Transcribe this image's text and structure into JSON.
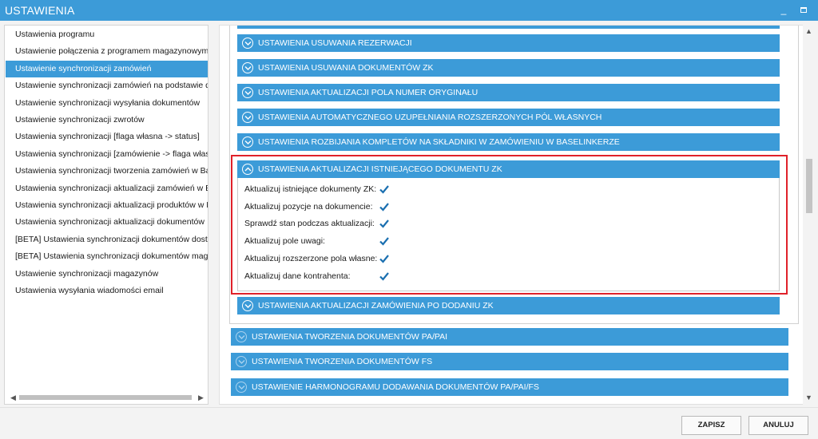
{
  "window": {
    "title": "USTAWIENIA",
    "minimize_icon": "minimize-icon",
    "maximize_icon": "maximize-icon"
  },
  "sidebar": {
    "items": [
      {
        "label": "Ustawienia programu",
        "selected": false
      },
      {
        "label": "Ustawienie połączenia z programem magazynowym",
        "selected": false
      },
      {
        "label": "Ustawienie synchronizacji zamówień",
        "selected": true
      },
      {
        "label": "Ustawienie synchronizacji zamówień na podstawie dzi",
        "selected": false
      },
      {
        "label": "Ustawienie synchronizacji wysyłania dokumentów",
        "selected": false
      },
      {
        "label": "Ustawienie synchronizacji zwrotów",
        "selected": false
      },
      {
        "label": "Ustawienia synchronizacji [flaga własna -> status]",
        "selected": false
      },
      {
        "label": "Ustawienia synchronizacji [zamówienie -> flaga własn",
        "selected": false
      },
      {
        "label": "Ustawienia synchronizacji tworzenia zamówień w Base",
        "selected": false
      },
      {
        "label": "Ustawienia synchronizacji aktualizacji zamówień w Ba",
        "selected": false
      },
      {
        "label": "Ustawienia synchronizacji aktualizacji produktów w Bas",
        "selected": false
      },
      {
        "label": "Ustawienia synchronizacji aktualizacji dokumentów",
        "selected": false
      },
      {
        "label": "[BETA] Ustawienia synchronizacji dokumentów dostaw",
        "selected": false
      },
      {
        "label": "[BETA] Ustawienia synchronizacji dokumentów magaz",
        "selected": false
      },
      {
        "label": "Ustawienie synchronizacji magazynów",
        "selected": false
      },
      {
        "label": "Ustawienia wysyłania wiadomości email",
        "selected": false
      }
    ]
  },
  "sections": {
    "inner": [
      "USTAWIENIA USUWANIA REZERWACJI",
      "USTAWIENIA USUWANIA DOKUMENTÓW ZK",
      "USTAWIENIA AKTUALIZACJI POLA NUMER ORYGINAŁU",
      "USTAWIENIA AUTOMATYCZNEGO UZUPEŁNIANIA ROZSZERZONYCH PÓL WŁASNYCH",
      "USTAWIENIA ROZBIJANIA KOMPLETÓW NA SKŁADNIKI W ZAMÓWIENIU W BASELINKERZE"
    ],
    "expanded": {
      "title": "USTAWIENIA AKTUALIZACJI ISTNIEJĄCEGO DOKUMENTU ZK",
      "options": [
        {
          "label": "Aktualizuj istniejące dokumenty ZK:",
          "checked": true
        },
        {
          "label": "Aktualizuj pozycje na dokumencie:",
          "checked": true
        },
        {
          "label": "Sprawdź stan podczas aktualizacji:",
          "checked": true
        },
        {
          "label": "Aktualizuj pole uwagi:",
          "checked": true
        },
        {
          "label": "Aktualizuj rozszerzone pola własne:",
          "checked": true
        },
        {
          "label": "Aktualizuj dane kontrahenta:",
          "checked": true
        }
      ]
    },
    "after_expanded": "USTAWIENIA AKTUALIZACJI ZAMÓWIENIA PO DODANIU ZK",
    "outer": [
      "USTAWIENIA TWORZENIA DOKUMENTÓW PA/PAI",
      "USTAWIENIA TWORZENIA DOKUMENTÓW FS",
      "USTAWIENIE HARMONOGRAMU DODAWANIA DOKUMENTÓW PA/PAI/FS"
    ]
  },
  "footer": {
    "save_label": "ZAPISZ",
    "cancel_label": "ANULUJ"
  },
  "colors": {
    "accent": "#3c9bd8",
    "highlight": "#e0212a"
  }
}
